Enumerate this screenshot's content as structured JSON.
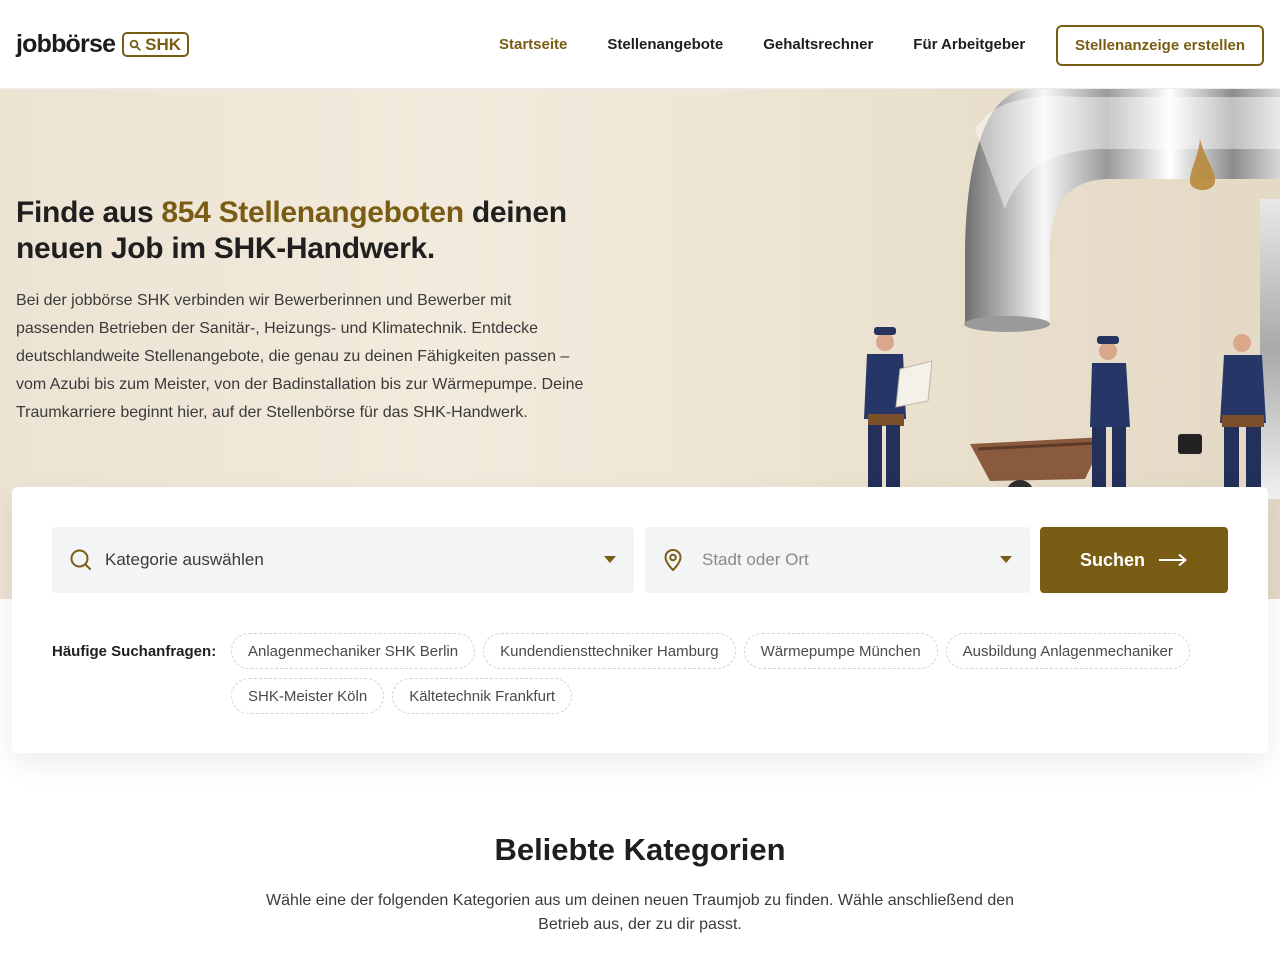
{
  "header": {
    "logo_word": "jobbörse",
    "logo_badge": "SHK",
    "nav": [
      {
        "label": "Startseite",
        "active": true
      },
      {
        "label": "Stellenangebote",
        "active": false
      },
      {
        "label": "Gehaltsrechner",
        "active": false
      },
      {
        "label": "Für Arbeitgeber",
        "active": false
      }
    ],
    "cta_label": "Stellenanzeige erstellen"
  },
  "hero": {
    "title_prefix": "Finde aus ",
    "title_highlight": "854 Stellenangeboten",
    "title_suffix": " deinen neuen Job im SHK-Handwerk.",
    "description": "Bei der jobbörse SHK verbinden wir Bewerberinnen und Bewerber mit passenden Betrieben der Sanitär-, Heizungs- und Klimatechnik. Entdecke deutschlandweite Stellenangebote, die genau zu deinen Fähigkeiten passen – vom Azubi bis zum Meister, von der Badinstallation bis zur Wärmepumpe. Deine Traumkarriere beginnt hier, auf der Stellenbörse für das SHK-Handwerk."
  },
  "search": {
    "category_value": "Kategorie auswählen",
    "location_placeholder": "Stadt oder Ort",
    "button_label": "Suchen",
    "frequent_label": "Häufige Suchanfragen:",
    "frequent_queries": [
      "Anlagenmechaniker SHK Berlin",
      "Kundendiensttechniker Hamburg",
      "Wärmepumpe München",
      "Ausbildung Anlagenmechaniker",
      "SHK-Meister Köln",
      "Kältetechnik Frankfurt"
    ]
  },
  "categories": {
    "title": "Beliebte Kategorien",
    "text": "Wähle eine der folgenden Kategorien aus um deinen neuen Traumjob zu finden. Wähle anschließend den Betrieb aus, der zu dir passt."
  },
  "colors": {
    "accent": "#7a5d14",
    "hero_bg": "#efe6d7",
    "field_bg": "#f2f4f6",
    "text": "#1f1f1f"
  },
  "icons": {
    "logo_badge": "search-icon",
    "category_field": "search-icon",
    "location_field": "map-pin-icon",
    "search_button": "arrow-right-icon",
    "dropdown": "caret-down-icon"
  }
}
